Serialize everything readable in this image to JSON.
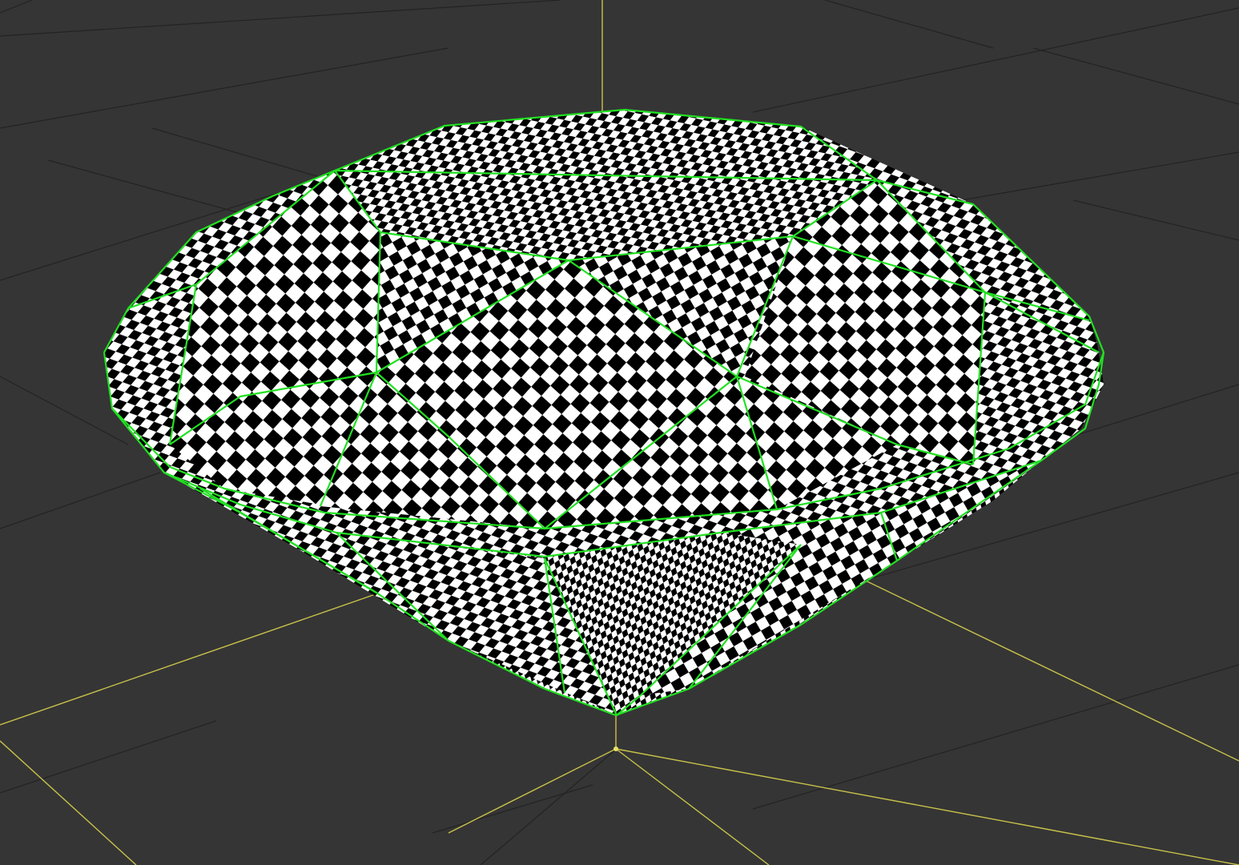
{
  "viewport": {
    "background_color": "#353535",
    "grid_color": "#232323",
    "axis_color": "#c9c24a",
    "wireframe_color": "#22e022",
    "checker_dark": "#000000",
    "checker_light": "#ffffff",
    "object": "gem-mesh-with-checker-uv-texture",
    "selection": "wireframe-highlighted"
  }
}
